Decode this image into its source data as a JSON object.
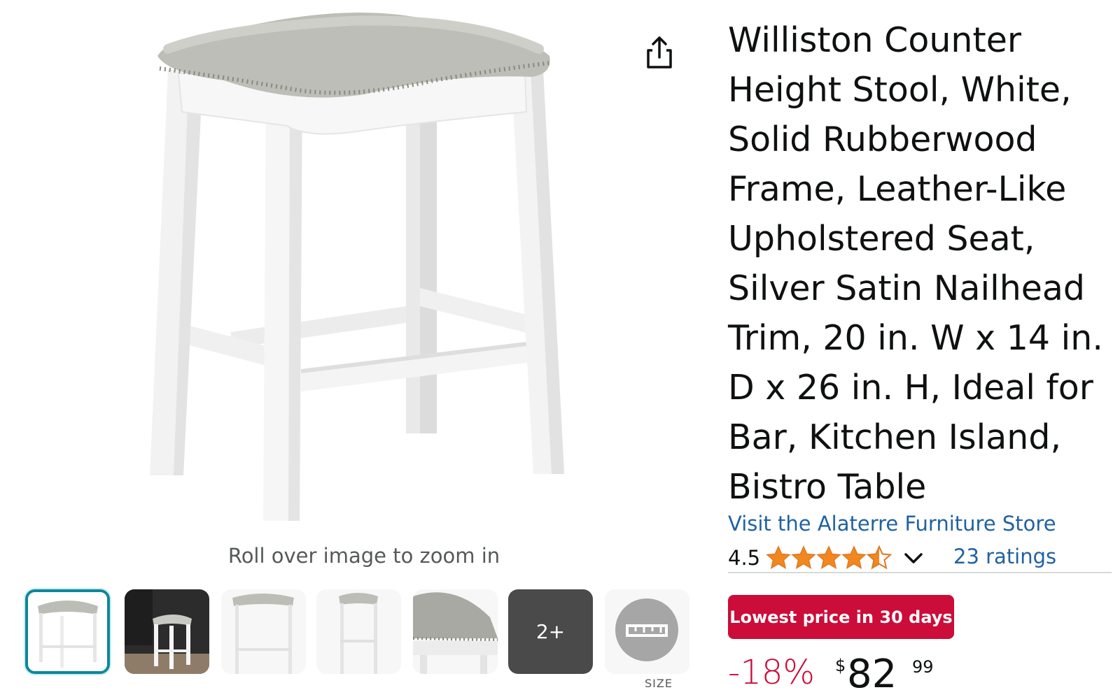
{
  "product": {
    "title": "Williston Counter Height Stool, White, Solid Rubberwood Frame, Leather-Like Upholstered Seat, Silver Satin Nailhead Trim, 20 in. W x 14 in. D x 26 in. H, Ideal for Bar, Kitchen Island, Bistro Table",
    "store_link": "Visit the Alaterre Furniture Store",
    "rating_value": "4.5",
    "rating_stars": 4.5,
    "ratings_count": "23 ratings",
    "deal_badge": "Lowest price in 30 days",
    "discount": "-18%",
    "price_currency": "$",
    "price_whole": "82",
    "price_fraction": "99"
  },
  "gallery": {
    "zoom_hint": "Roll over image to zoom in",
    "more_label": "2+",
    "size_label": "SIZE",
    "thumbnails": [
      {
        "name": "front-view",
        "selected": true
      },
      {
        "name": "lifestyle-kitchen"
      },
      {
        "name": "angle-view"
      },
      {
        "name": "side-view"
      },
      {
        "name": "seat-detail"
      },
      {
        "name": "more"
      },
      {
        "name": "size-chart"
      }
    ]
  },
  "icons": {
    "share": "share-icon",
    "star": "star-icon",
    "chevron": "chevron-down-icon",
    "ruler": "ruler-icon"
  },
  "colors": {
    "link": "#2162a1",
    "deal_red": "#cc0c39",
    "star_orange": "#f3871f",
    "thumb_selected": "#10869a",
    "seat_gray": "#b8b8b2"
  }
}
